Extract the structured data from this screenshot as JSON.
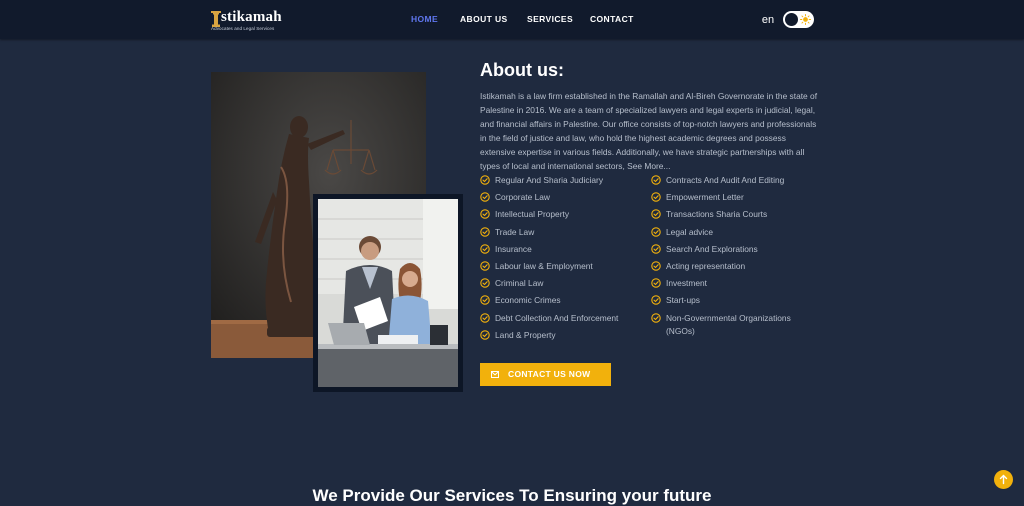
{
  "brand": {
    "name": "Istikamah",
    "name_display": "stikamah",
    "tagline": "Advocates and Legal Services"
  },
  "nav": {
    "items": [
      {
        "label": "HOME",
        "active": true
      },
      {
        "label": "ABOUT US",
        "active": false
      },
      {
        "label": "SERVICES",
        "active": false
      },
      {
        "label": "CONTACT",
        "active": false
      }
    ],
    "language": "en",
    "theme_toggle_icon": "sun-icon"
  },
  "about": {
    "title": "About us:",
    "description": "Istikamah is a law firm established in the Ramallah and Al-Bireh Governorate in the state of Palestine in 2016. We are a team of specialized lawyers and legal experts in judicial, legal, and financial affairs in Palestine. Our office consists of top-notch lawyers and professionals in the field of justice and law, who hold the highest academic degrees and possess extensive expertise in various fields. Additionally, we have strategic partnerships with all types of local and international sectors, See More...",
    "services_left": [
      "Regular And Sharia Judiciary",
      "Corporate Law",
      "Intellectual Property",
      "Trade Law",
      "Insurance",
      "Labour law & Employment",
      "Criminal Law",
      "Economic Crimes",
      "Debt Collection And Enforcement",
      "Land & Property"
    ],
    "services_right": [
      "Contracts And Audit And Editing",
      "Empowerment Letter",
      "Transactions Sharia Courts",
      "Legal advice",
      "Search And Explorations",
      "Acting representation",
      "Investment",
      "Start-ups",
      "Non-Governmental Organizations",
      "(NGOs)"
    ],
    "cta_label": "CONTACT US NOW",
    "cta_icon": "mail-icon"
  },
  "next_section_title": "We Provide Our Services To Ensuring your future",
  "colors": {
    "background": "#1f2a3f",
    "navbar": "#111a2c",
    "accent": "#f2b10c",
    "nav_active": "#5f76ee"
  }
}
